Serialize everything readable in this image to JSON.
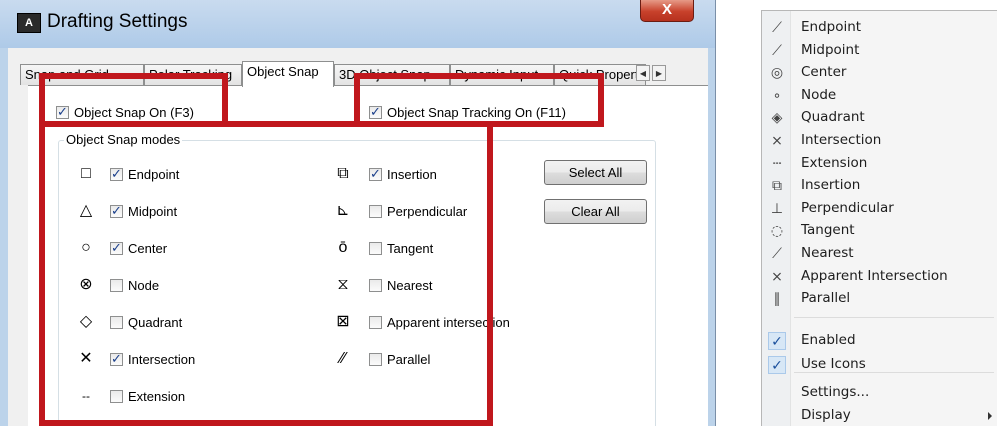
{
  "dialog": {
    "title": "Drafting Settings",
    "close_label": "X",
    "app_icon": "AutoCAD-logo-icon",
    "tabs": [
      {
        "label": "Snap and Grid"
      },
      {
        "label": "Polar Tracking"
      },
      {
        "label": "Object Snap"
      },
      {
        "label": "3D Object Snap"
      },
      {
        "label": "Dynamic Input"
      },
      {
        "label": "Quick Propert"
      }
    ],
    "active_tab": "Object Snap",
    "snap_on": {
      "label": "Object Snap On (F3)",
      "checked": true
    },
    "tracking_on": {
      "label": "Object Snap Tracking On (F11)",
      "checked": true
    },
    "group_title": "Object Snap modes",
    "modes_left": [
      {
        "label": "Endpoint",
        "checked": true,
        "symbol": "□"
      },
      {
        "label": "Midpoint",
        "checked": true,
        "symbol": "△"
      },
      {
        "label": "Center",
        "checked": true,
        "symbol": "○"
      },
      {
        "label": "Node",
        "checked": false,
        "symbol": "⊗"
      },
      {
        "label": "Quadrant",
        "checked": false,
        "symbol": "◇"
      },
      {
        "label": "Intersection",
        "checked": true,
        "symbol": "✕"
      },
      {
        "label": "Extension",
        "checked": false,
        "symbol": "--"
      }
    ],
    "modes_right": [
      {
        "label": "Insertion",
        "checked": true,
        "symbol": "⧉"
      },
      {
        "label": "Perpendicular",
        "checked": false,
        "symbol": "⊾"
      },
      {
        "label": "Tangent",
        "checked": false,
        "symbol": "ō"
      },
      {
        "label": "Nearest",
        "checked": false,
        "symbol": "⧖"
      },
      {
        "label": "Apparent intersection",
        "checked": false,
        "symbol": "⊠"
      },
      {
        "label": "Parallel",
        "checked": false,
        "symbol": "∕∕"
      }
    ],
    "select_all_label": "Select All",
    "clear_all_label": "Clear All",
    "highlight_color": "#c0171d"
  },
  "menu": {
    "snap_items": [
      {
        "label": "Endpoint",
        "icon": "endpoint-icon",
        "glyph": "⟋"
      },
      {
        "label": "Midpoint",
        "icon": "midpoint-icon",
        "glyph": "⟋"
      },
      {
        "label": "Center",
        "icon": "center-icon",
        "glyph": "◎"
      },
      {
        "label": "Node",
        "icon": "node-icon",
        "glyph": "∘"
      },
      {
        "label": "Quadrant",
        "icon": "quadrant-icon",
        "glyph": "◈"
      },
      {
        "label": "Intersection",
        "icon": "intersection-icon",
        "glyph": "⨯"
      },
      {
        "label": "Extension",
        "icon": "extension-icon",
        "glyph": "┄"
      },
      {
        "label": "Insertion",
        "icon": "insertion-icon",
        "glyph": "⧉"
      },
      {
        "label": "Perpendicular",
        "icon": "perpendicular-icon",
        "glyph": "⊥"
      },
      {
        "label": "Tangent",
        "icon": "tangent-icon",
        "glyph": "◌"
      },
      {
        "label": "Nearest",
        "icon": "nearest-icon",
        "glyph": "⟋"
      },
      {
        "label": "Apparent Intersection",
        "icon": "apparent-intersection-icon",
        "glyph": "⨯"
      },
      {
        "label": "Parallel",
        "icon": "parallel-icon",
        "glyph": "∥"
      }
    ],
    "toggle_items": [
      {
        "label": "Enabled",
        "checked": true
      },
      {
        "label": "Use Icons",
        "checked": true
      }
    ],
    "settings_label": "Settings...",
    "display_label": "Display"
  }
}
